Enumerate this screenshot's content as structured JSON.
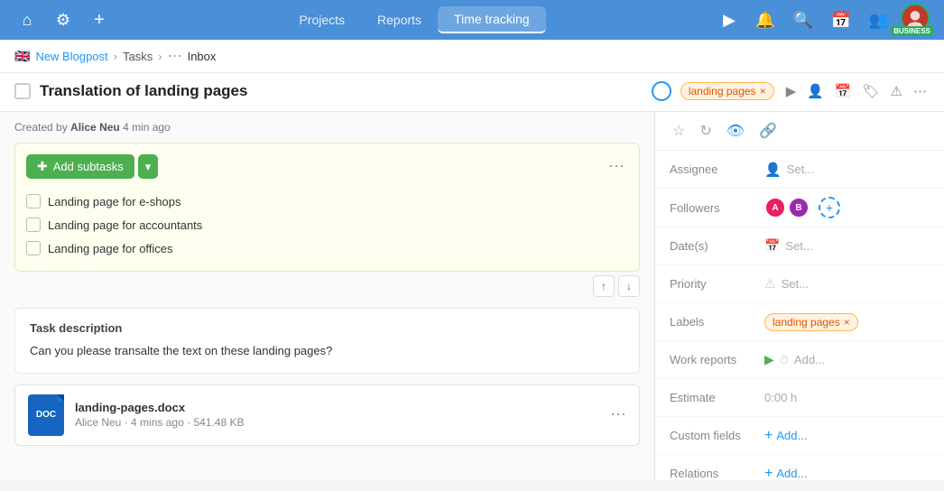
{
  "nav": {
    "links": [
      "Projects",
      "Reports",
      "Time tracking"
    ],
    "active_link": "Time tracking",
    "icons": {
      "home": "🏠",
      "settings": "⚙️",
      "add": "+",
      "play": "▶",
      "notifications": "🔔",
      "search": "🔍",
      "calendar": "📅",
      "users": "👥"
    }
  },
  "breadcrumb": {
    "flag": "🇬🇧",
    "project": "New Blogpost",
    "tasks_label": "Tasks",
    "inbox_label": "Inbox"
  },
  "task": {
    "title": "Translation of landing pages",
    "tag": "landing pages",
    "created_by": "Alice Neu",
    "created_ago": "4 min ago"
  },
  "subtasks": {
    "add_button": "Add subtasks",
    "items": [
      "Landing page for e-shops",
      "Landing page for accountants",
      "Landing page for offices"
    ]
  },
  "description": {
    "title": "Task description",
    "text": "Can you please transalte the text on these landing pages?"
  },
  "attachment": {
    "name": "landing-pages.docx",
    "author": "Alice Neu",
    "time_ago": "4 mins ago",
    "size": "541.48 KB",
    "doc_label": "DOC"
  },
  "right_panel": {
    "assignee_label": "Assignee",
    "assignee_value": "Set...",
    "followers_label": "Followers",
    "followers": [
      {
        "color": "#e91e63",
        "initials": "A"
      },
      {
        "color": "#9c27b0",
        "initials": "B"
      }
    ],
    "dates_label": "Date(s)",
    "dates_value": "Set...",
    "priority_label": "Priority",
    "priority_value": "Set...",
    "labels_label": "Labels",
    "labels_tag": "landing pages",
    "work_reports_label": "Work reports",
    "work_reports_value": "Add...",
    "estimate_label": "Estimate",
    "estimate_value": "0:00 h",
    "custom_fields_label": "Custom fields",
    "custom_fields_value": "Add...",
    "relations_label": "Relations",
    "relations_value": "Add..."
  }
}
